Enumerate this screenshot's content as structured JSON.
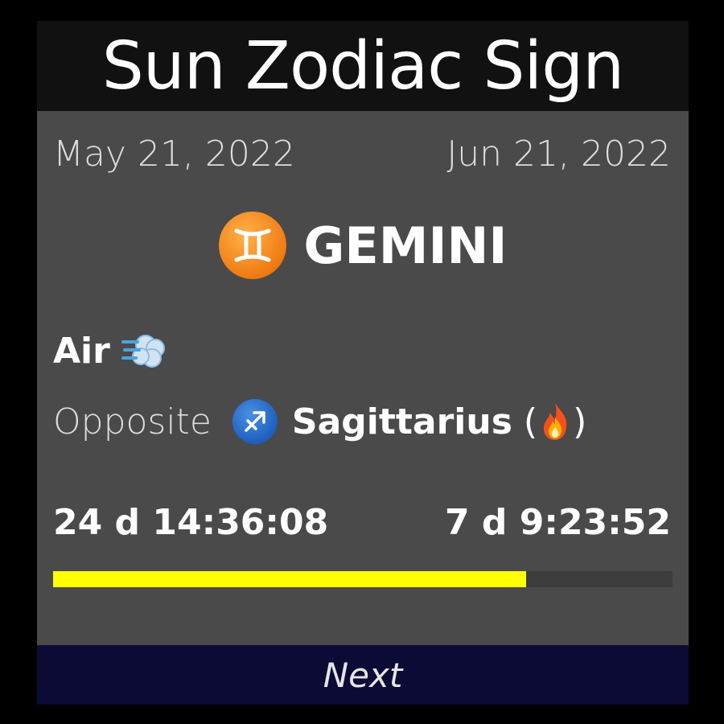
{
  "header": {
    "title": "Sun Zodiac Sign"
  },
  "period": {
    "start_date": "May 21, 2022",
    "end_date": "Jun 21, 2022"
  },
  "sign": {
    "name": "GEMINI",
    "icon": "gemini-icon",
    "symbol": "♊",
    "badge_color": "#f07a12"
  },
  "element": {
    "label": "Air",
    "icon": "wind-icon"
  },
  "opposite": {
    "label": "Opposite",
    "sign_name": "Sagittarius",
    "sign_icon": "sagittarius-icon",
    "sign_symbol": "♐",
    "element_icon": "fire-icon",
    "badge_color": "#1e5fc0"
  },
  "timers": {
    "elapsed": "24 d 14:36:08",
    "remaining": "7 d 9:23:52"
  },
  "progress": {
    "fraction": 0.764,
    "fill_color": "#ffff00"
  },
  "footer": {
    "next_label": "Next"
  }
}
